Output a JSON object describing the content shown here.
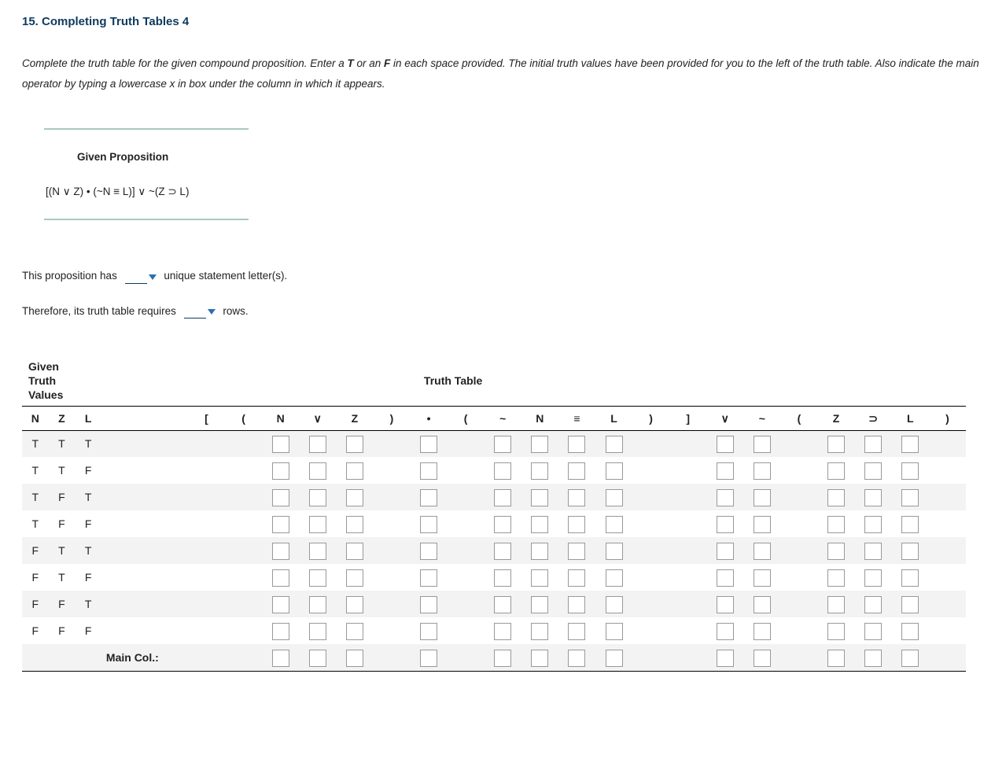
{
  "question": {
    "number_title": "15. Completing Truth Tables 4",
    "instructions_a": "Complete the truth table for the given compound proposition. Enter a ",
    "instructions_b": "T",
    "instructions_c": " or an ",
    "instructions_d": "F",
    "instructions_e": " in each space provided. The initial truth values have been provided for you to the left of the truth table. Also indicate the main operator by typing a lowercase x in box under the column in which it appears."
  },
  "proposition": {
    "label": "Given Proposition",
    "expression": "[(N ∨ Z) • (~N ≡ L)] ∨ ~(Z ⊃ L)"
  },
  "sentences": {
    "s1a": "This proposition has",
    "s1b": "unique statement letter(s).",
    "s2a": "Therefore, its truth table requires",
    "s2b": "rows."
  },
  "table": {
    "top_left": "Given Truth Values",
    "top_right": "Truth Table",
    "given_headers": [
      "N",
      "Z",
      "L"
    ],
    "symbols": [
      "[",
      "(",
      "N",
      "∨",
      "Z",
      ")",
      "•",
      "(",
      "~",
      "N",
      "≡",
      "L",
      ")",
      "]",
      "∨",
      "~",
      "(",
      "Z",
      "⊃",
      "L",
      ")"
    ],
    "input_cols": [
      2,
      3,
      4,
      6,
      8,
      9,
      10,
      11,
      14,
      15,
      17,
      18,
      19
    ],
    "given_rows": [
      [
        "T",
        "T",
        "T"
      ],
      [
        "T",
        "T",
        "F"
      ],
      [
        "T",
        "F",
        "T"
      ],
      [
        "T",
        "F",
        "F"
      ],
      [
        "F",
        "T",
        "T"
      ],
      [
        "F",
        "T",
        "F"
      ],
      [
        "F",
        "F",
        "T"
      ],
      [
        "F",
        "F",
        "F"
      ]
    ],
    "main_label": "Main Col.:"
  }
}
